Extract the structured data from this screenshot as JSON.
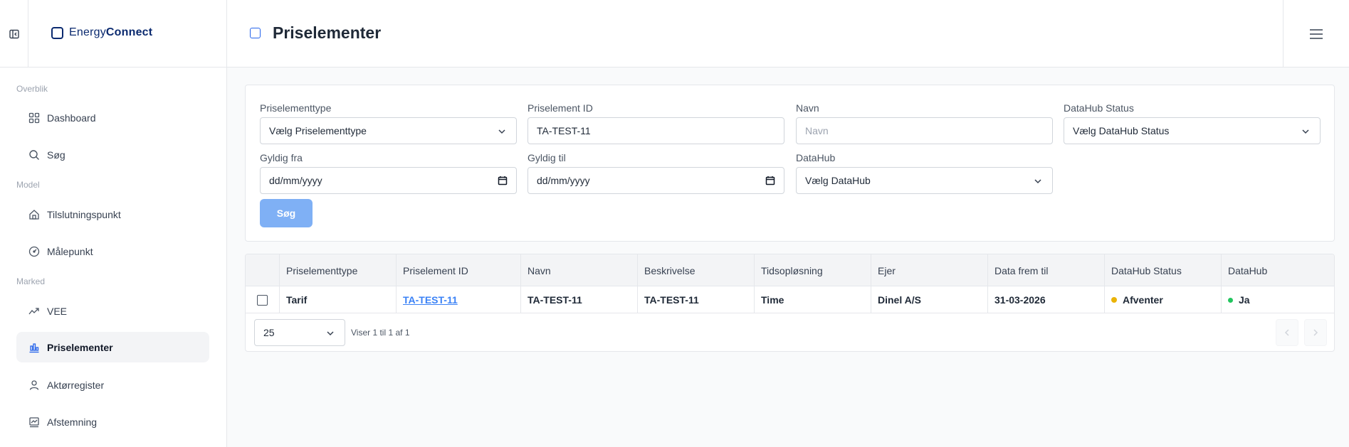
{
  "app": {
    "logo_prefix": "Energy",
    "logo_suffix": "Connect"
  },
  "sidebar": {
    "sections": [
      {
        "label": "Overblik"
      },
      {
        "label": "Model"
      },
      {
        "label": "Marked"
      }
    ],
    "items": [
      {
        "label": "Dashboard",
        "icon": "grid-icon"
      },
      {
        "label": "Søg",
        "icon": "search-icon"
      },
      {
        "label": "Tilslutningspunkt",
        "icon": "home-icon"
      },
      {
        "label": "Målepunkt",
        "icon": "gauge-icon"
      },
      {
        "label": "VEE",
        "icon": "trend-icon"
      },
      {
        "label": "Priselementer",
        "icon": "price-chart-icon",
        "active": true
      },
      {
        "label": "Aktørregister",
        "icon": "user-icon"
      },
      {
        "label": "Afstemning",
        "icon": "reconcile-icon"
      }
    ]
  },
  "header": {
    "title": "Priselementer"
  },
  "filters": {
    "type": {
      "label": "Priselementtype",
      "value": "Vælg Priselementtype"
    },
    "id": {
      "label": "Priselement ID",
      "value": "TA-TEST-11"
    },
    "name": {
      "label": "Navn",
      "placeholder": "Navn"
    },
    "datahub_status": {
      "label": "DataHub Status",
      "value": "Vælg DataHub Status"
    },
    "valid_from": {
      "label": "Gyldig fra",
      "value": "dd/mm/yyyy"
    },
    "valid_to": {
      "label": "Gyldig til",
      "value": "dd/mm/yyyy"
    },
    "datahub": {
      "label": "DataHub",
      "value": "Vælg DataHub"
    },
    "search_label": "Søg"
  },
  "table": {
    "columns": [
      "Priselementtype",
      "Priselement ID",
      "Navn",
      "Beskrivelse",
      "Tidsopløsning",
      "Ejer",
      "Data frem til",
      "DataHub Status",
      "DataHub"
    ],
    "rows": [
      {
        "type": "Tarif",
        "id": "TA-TEST-11",
        "name": "TA-TEST-11",
        "description": "TA-TEST-11",
        "resolution": "Time",
        "owner": "Dinel A/S",
        "data_until": "31-03-2026",
        "datahub_status": "Afventer",
        "datahub_status_color": "#eab308",
        "datahub": "Ja",
        "datahub_color": "#22c55e"
      }
    ]
  },
  "pagination": {
    "page_size": "25",
    "info": "Viser 1 til 1 af 1"
  }
}
